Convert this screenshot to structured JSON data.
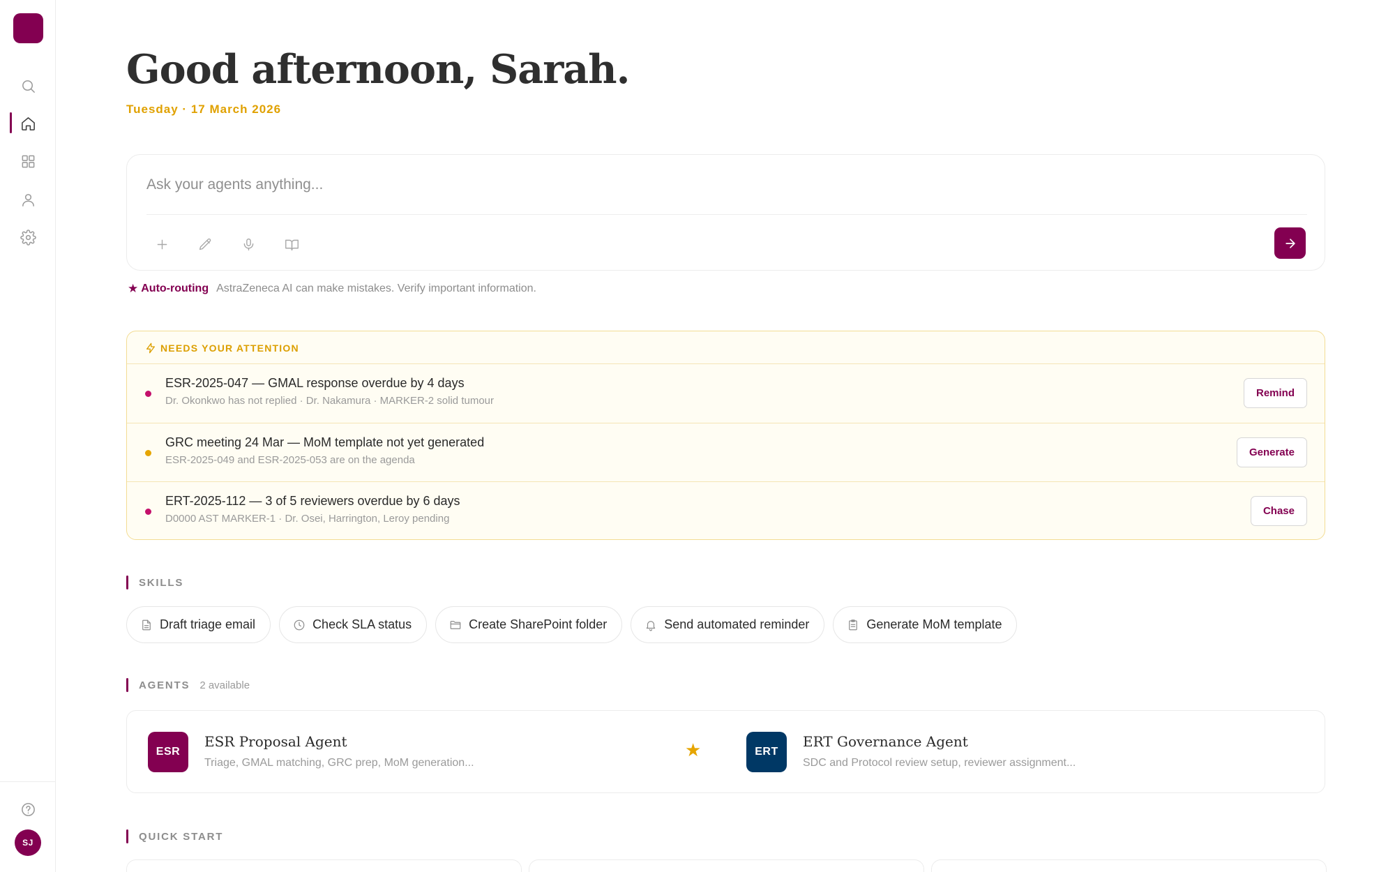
{
  "app": {
    "brand_color": "#830051",
    "accent_color": "#e0a100"
  },
  "sidebar": {
    "logo": "app-logo",
    "items": [
      {
        "name": "search",
        "icon": "search-icon",
        "active": false
      },
      {
        "name": "home",
        "icon": "home-icon",
        "active": true
      },
      {
        "name": "apps",
        "icon": "grid-icon",
        "active": false
      },
      {
        "name": "profile",
        "icon": "user-icon",
        "active": false
      },
      {
        "name": "settings",
        "icon": "gear-icon",
        "active": false
      }
    ],
    "help_icon": "help-icon",
    "avatar_initials": "SJ"
  },
  "header": {
    "greeting": "Good afternoon, Sarah.",
    "date": "Tuesday · 17 March 2026"
  },
  "composer": {
    "placeholder": "Ask your agents anything...",
    "value": "",
    "tools": [
      "plus-icon",
      "pencil-icon",
      "microphone-icon",
      "book-icon"
    ],
    "send_icon": "arrow-right-icon"
  },
  "routing": {
    "star": "★",
    "label": "Auto-routing",
    "disclaimer": "AstraZeneca AI can make mistakes. Verify important information."
  },
  "attention": {
    "title": "NEEDS YOUR ATTENTION",
    "items": [
      {
        "title": "ESR-2025-047 — GMAL response overdue by 4 days",
        "subtitle": "Dr. Okonkwo has not replied · Dr. Nakamura · MARKER-2 solid tumour",
        "action": "Remind",
        "dot_color": "#c4106b"
      },
      {
        "title": "GRC meeting 24 Mar — MoM template not yet generated",
        "subtitle": "ESR-2025-049 and ESR-2025-053 are on the agenda",
        "action": "Generate",
        "dot_color": "#e6a500"
      },
      {
        "title": "ERT-2025-112 — 3 of 5 reviewers overdue by 6 days",
        "subtitle": "D0000 AST MARKER-1 · Dr. Osei, Harrington, Leroy pending",
        "action": "Chase",
        "dot_color": "#c4106b"
      }
    ]
  },
  "skills": {
    "title": "SKILLS",
    "items": [
      {
        "label": "Draft triage email",
        "icon": "document-icon"
      },
      {
        "label": "Check SLA status",
        "icon": "clock-icon"
      },
      {
        "label": "Create SharePoint folder",
        "icon": "folder-icon"
      },
      {
        "label": "Send automated reminder",
        "icon": "bell-icon"
      },
      {
        "label": "Generate MoM template",
        "icon": "clipboard-icon"
      }
    ]
  },
  "agents": {
    "title": "AGENTS",
    "count": "2 available",
    "items": [
      {
        "badge": "ESR",
        "name": "ESR Proposal Agent",
        "description": "Triage, GMAL matching, GRC prep, MoM generation...",
        "badge_color": "#830051",
        "favorite": true
      },
      {
        "badge": "ERT",
        "name": "ERT Governance Agent",
        "description": "SDC and Protocol review setup, reviewer assignment...",
        "badge_color": "#003865",
        "favorite": false
      }
    ]
  },
  "quick_start": {
    "title": "QUICK START"
  }
}
